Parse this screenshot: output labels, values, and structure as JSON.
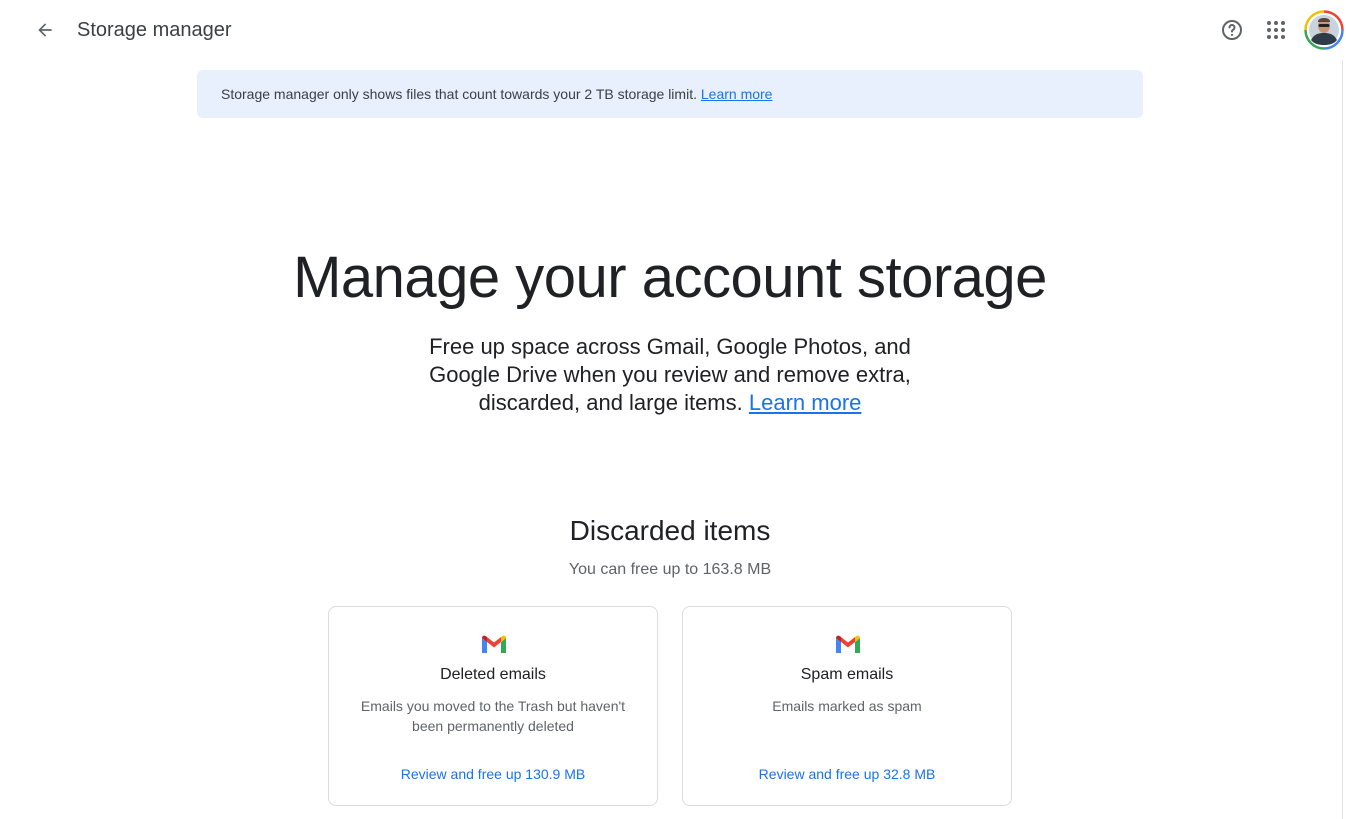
{
  "header": {
    "title": "Storage manager",
    "back_icon": "arrow-back-icon",
    "help_icon": "help-circle-icon",
    "apps_icon": "apps-grid-icon",
    "avatar_icon": "account-avatar"
  },
  "banner": {
    "text": "Storage manager only shows files that count towards your 2 TB storage limit. ",
    "link": "Learn more"
  },
  "hero": {
    "title": "Manage your account storage",
    "subtitle": "Free up space across Gmail, Google Photos, and Google Drive when you review and remove extra, discarded, and large items. ",
    "link": "Learn more"
  },
  "discarded": {
    "title": "Discarded items",
    "subtitle": "You can free up to 163.8 MB",
    "cards": [
      {
        "icon": "gmail-icon",
        "title": "Deleted emails",
        "description": "Emails you moved to the Trash but haven't been permanently deleted",
        "action": "Review and free up 130.9 MB"
      },
      {
        "icon": "gmail-icon",
        "title": "Spam emails",
        "description": "Emails marked as spam",
        "action": "Review and free up 32.8 MB"
      }
    ]
  },
  "colors": {
    "accent": "#1a73e8",
    "banner_bg": "#e8f0fe",
    "text_primary": "#202124",
    "text_secondary": "#5f6368"
  }
}
